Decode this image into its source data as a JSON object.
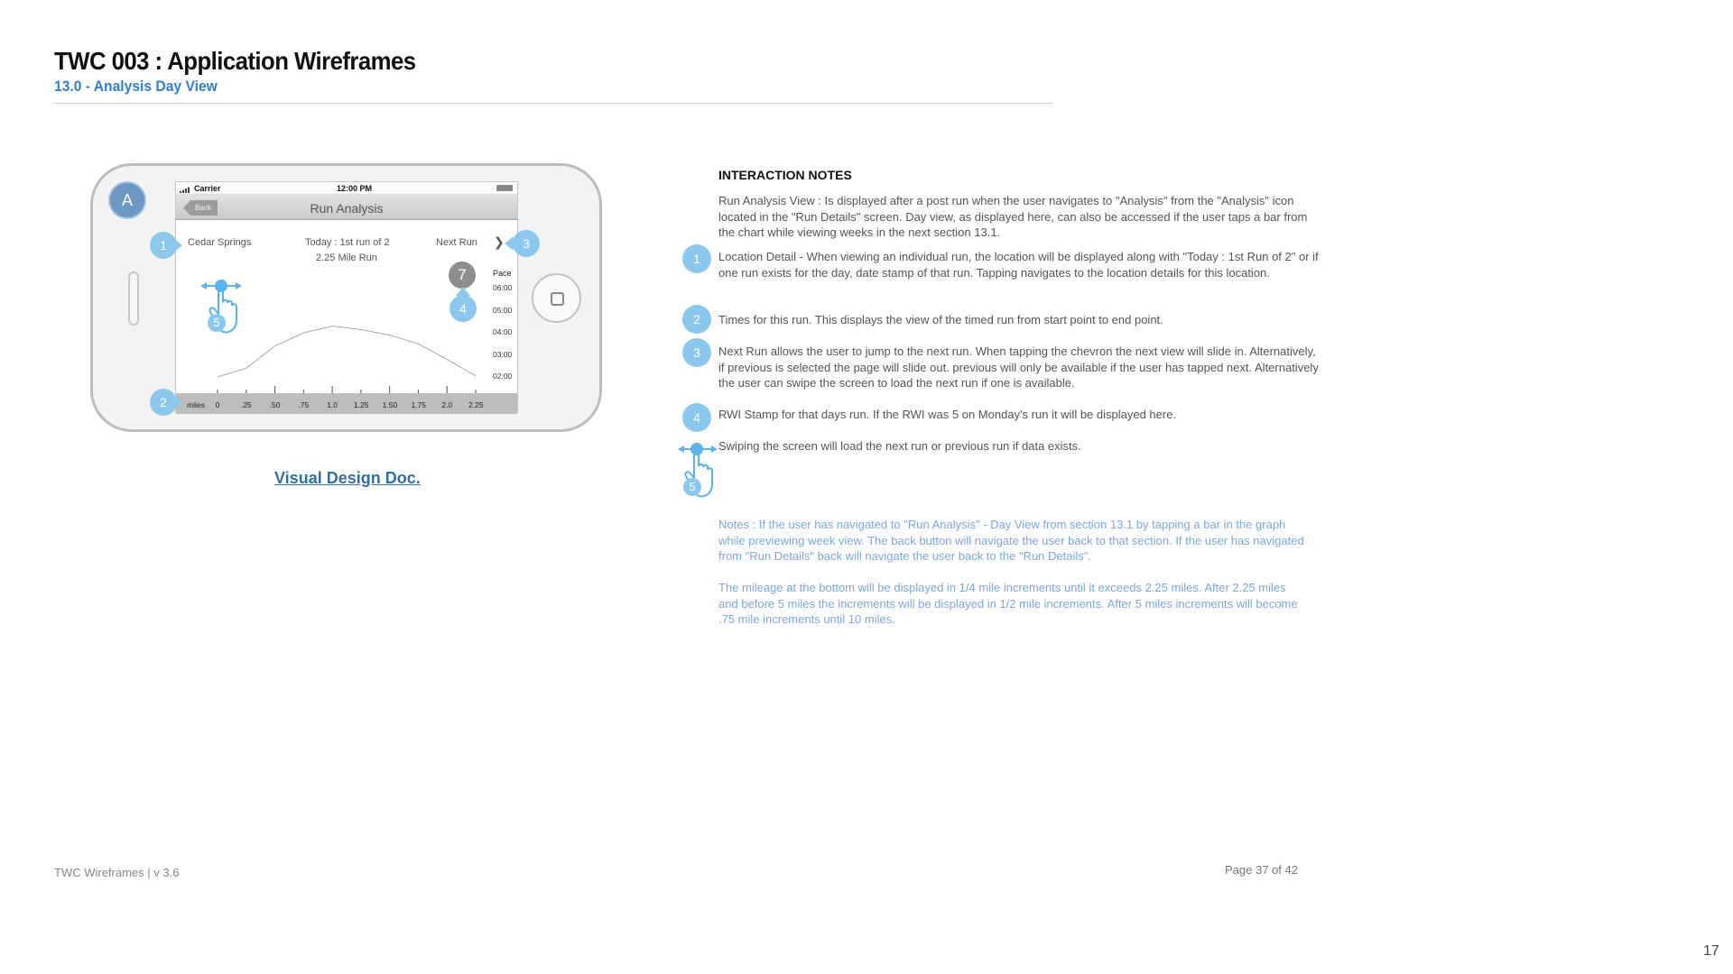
{
  "header": {
    "title": "TWC 003 : Application Wireframes",
    "subtitle": "13.0 - Analysis Day View"
  },
  "phone": {
    "badge": "A",
    "status": {
      "carrier": "Carrier",
      "time": "12:00 PM"
    },
    "nav": {
      "back": "Back",
      "title": "Run Analysis"
    },
    "location": "Cedar Springs",
    "today": "Today : 1st run of 2",
    "distance": "2.25 Mile Run",
    "next": "Next  Run",
    "rwi_value": "7",
    "callouts": [
      "1",
      "2",
      "3",
      "4",
      "5"
    ]
  },
  "chart_data": {
    "type": "line",
    "ylabel": "Pace",
    "y_ticks": [
      "06:00",
      "05:00",
      "04:00",
      "03:00",
      "02:00"
    ],
    "xlabel": "miles",
    "x_ticks": [
      "0",
      ".25",
      ".50",
      ".75",
      "1.0",
      "1.25",
      "1.50",
      "1.75",
      "2.0",
      "2.25"
    ],
    "x": [
      0,
      0.25,
      0.5,
      0.75,
      1.0,
      1.25,
      1.5,
      1.75,
      2.0,
      2.25
    ],
    "values": [
      2.0,
      2.4,
      3.4,
      4.0,
      4.3,
      4.15,
      3.9,
      3.5,
      2.8,
      2.05
    ],
    "ylim": [
      1.7,
      6.0
    ],
    "xlim": [
      0,
      2.25
    ]
  },
  "design_link": "Visual Design Doc.",
  "notes": {
    "heading": "INTERACTION NOTES",
    "intro": "Run Analysis View : Is displayed after a post run when the user navigates to \"Analysis\" from the \"Analysis\" icon located in the \"Run Details\" screen. Day view, as displayed here, can also be accessed if the user taps a bar from the chart while viewing weeks in the next section 13.1.",
    "items": [
      {
        "num": "1",
        "text": "Location Detail - When viewing an individual run, the location will be displayed along with \"Today : 1st Run of 2\" or if one run exists for the day, date stamp of that run. Tapping navigates to the location details for this location."
      },
      {
        "num": "2",
        "text": "Times for this run. This displays the view of the timed run from start point to end point."
      },
      {
        "num": "3",
        "text": "Next Run allows the user to jump to the next run. When tapping the chevron the next view will slide in. Alternatively, if previous is selected the page will slide out. previous will only be available if the user has tapped next. Alternatively the user can swipe the screen to load the next run if one is available."
      },
      {
        "num": "4",
        "text": "RWI Stamp for that days run. If the RWI was 5 on Monday's run it will be displayed here."
      },
      {
        "num": "5",
        "text": "Swiping the screen will load the next run or previous run if data exists."
      }
    ],
    "blue_1": "Notes : If the user has navigated to \"Run Analysis\" - Day View from section 13.1 by tapping a bar in the graph while previewing week view. The back button will navigate the user back to that section. If the user has navigated from \"Run Details\" back will navigate the user back to the \"Run Details\".",
    "blue_2": "The mileage at the bottom will be displayed in 1/4 mile increments until it exceeds 2.25 miles. After 2.25 miles and before 5 miles the increments will be displayed in 1/2 mile increments. After 5 miles increments will become .75 mile increments until 10 miles."
  },
  "footer": {
    "left": "TWC Wireframes | v 3.6",
    "page": "Page 37 of 42",
    "slide_number": "17"
  },
  "colors": {
    "accent": "#2f80d1",
    "callout": "#8cc8ee",
    "badge": "#6e98c4",
    "note_blue": "#7ba7e0"
  }
}
